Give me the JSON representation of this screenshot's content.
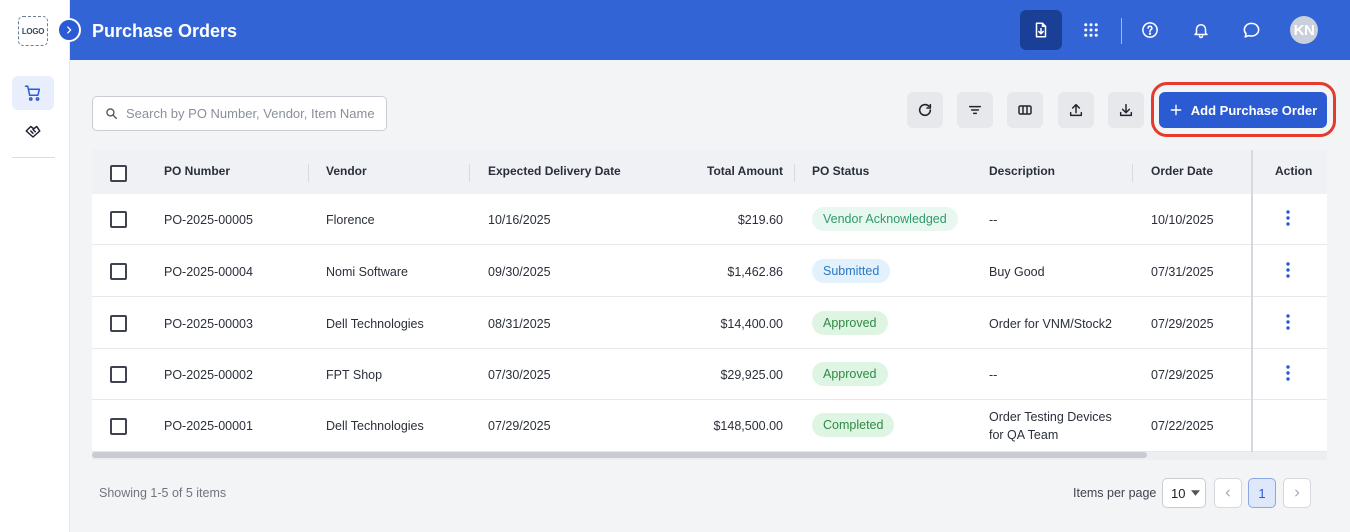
{
  "app": {
    "logo_text": "LOGO",
    "page_title": "Purchase Orders",
    "user_initials": "KN"
  },
  "colors": {
    "primary": "#3264d6",
    "primary_dark": "#1a3f96",
    "button_blue": "#2b5bd3",
    "highlight": "#e63a2c"
  },
  "header": {
    "icons": [
      "download-file-icon",
      "apps-grid-icon",
      "help-icon",
      "bell-icon",
      "chat-icon"
    ]
  },
  "sidebar": {
    "items": [
      {
        "icon": "cart-icon",
        "active": true
      },
      {
        "icon": "handshake-icon",
        "active": false
      }
    ]
  },
  "search": {
    "placeholder": "Search by PO Number, Vendor, Item Name",
    "value": ""
  },
  "toolbar": {
    "icons": [
      "refresh-icon",
      "filter-icon",
      "columns-icon",
      "upload-icon",
      "download-icon"
    ],
    "add_label": "Add Purchase Order"
  },
  "table": {
    "headers": {
      "po_number": "PO Number",
      "vendor": "Vendor",
      "expected": "Expected Delivery Date",
      "total": "Total Amount",
      "status": "PO Status",
      "description": "Description",
      "order_date": "Order Date",
      "action": "Action"
    },
    "rows": [
      {
        "po": "PO-2025-00005",
        "vendor": "Florence",
        "expected": "10/16/2025",
        "total": "$219.60",
        "status": "Vendor Acknowledged",
        "desc": "--",
        "desc2": "",
        "order": "10/10/2025",
        "has_action": true
      },
      {
        "po": "PO-2025-00004",
        "vendor": "Nomi Software",
        "expected": "09/30/2025",
        "total": "$1,462.86",
        "status": "Submitted",
        "desc": "Buy Good",
        "desc2": "",
        "order": "07/31/2025",
        "has_action": true
      },
      {
        "po": "PO-2025-00003",
        "vendor": "Dell Technologies",
        "expected": "08/31/2025",
        "total": "$14,400.00",
        "status": "Approved",
        "desc": "Order for VNM/Stock2",
        "desc2": "",
        "order": "07/29/2025",
        "has_action": true
      },
      {
        "po": "PO-2025-00002",
        "vendor": "FPT Shop",
        "expected": "07/30/2025",
        "total": "$29,925.00",
        "status": "Approved",
        "desc": "--",
        "desc2": "",
        "order": "07/29/2025",
        "has_action": true
      },
      {
        "po": "PO-2025-00001",
        "vendor": "Dell Technologies",
        "expected": "07/29/2025",
        "total": "$148,500.00",
        "status": "Completed",
        "desc": "Order Testing Devices",
        "desc2": "for QA Team",
        "order": "07/22/2025",
        "has_action": false
      }
    ],
    "status_colors": {
      "Vendor Acknowledged": {
        "bg": "#e8f7f0",
        "fg": "#2f9a6a"
      },
      "Submitted": {
        "bg": "#e3f1fc",
        "fg": "#2a78c2"
      },
      "Approved": {
        "bg": "#dff5e3",
        "fg": "#2e8a44"
      },
      "Completed": {
        "bg": "#dff5e3",
        "fg": "#2e8a44"
      }
    }
  },
  "footer": {
    "showing": "Showing 1-5 of 5 items",
    "items_per_page_label": "Items per page",
    "items_per_page_value": "10",
    "current_page": "1"
  }
}
